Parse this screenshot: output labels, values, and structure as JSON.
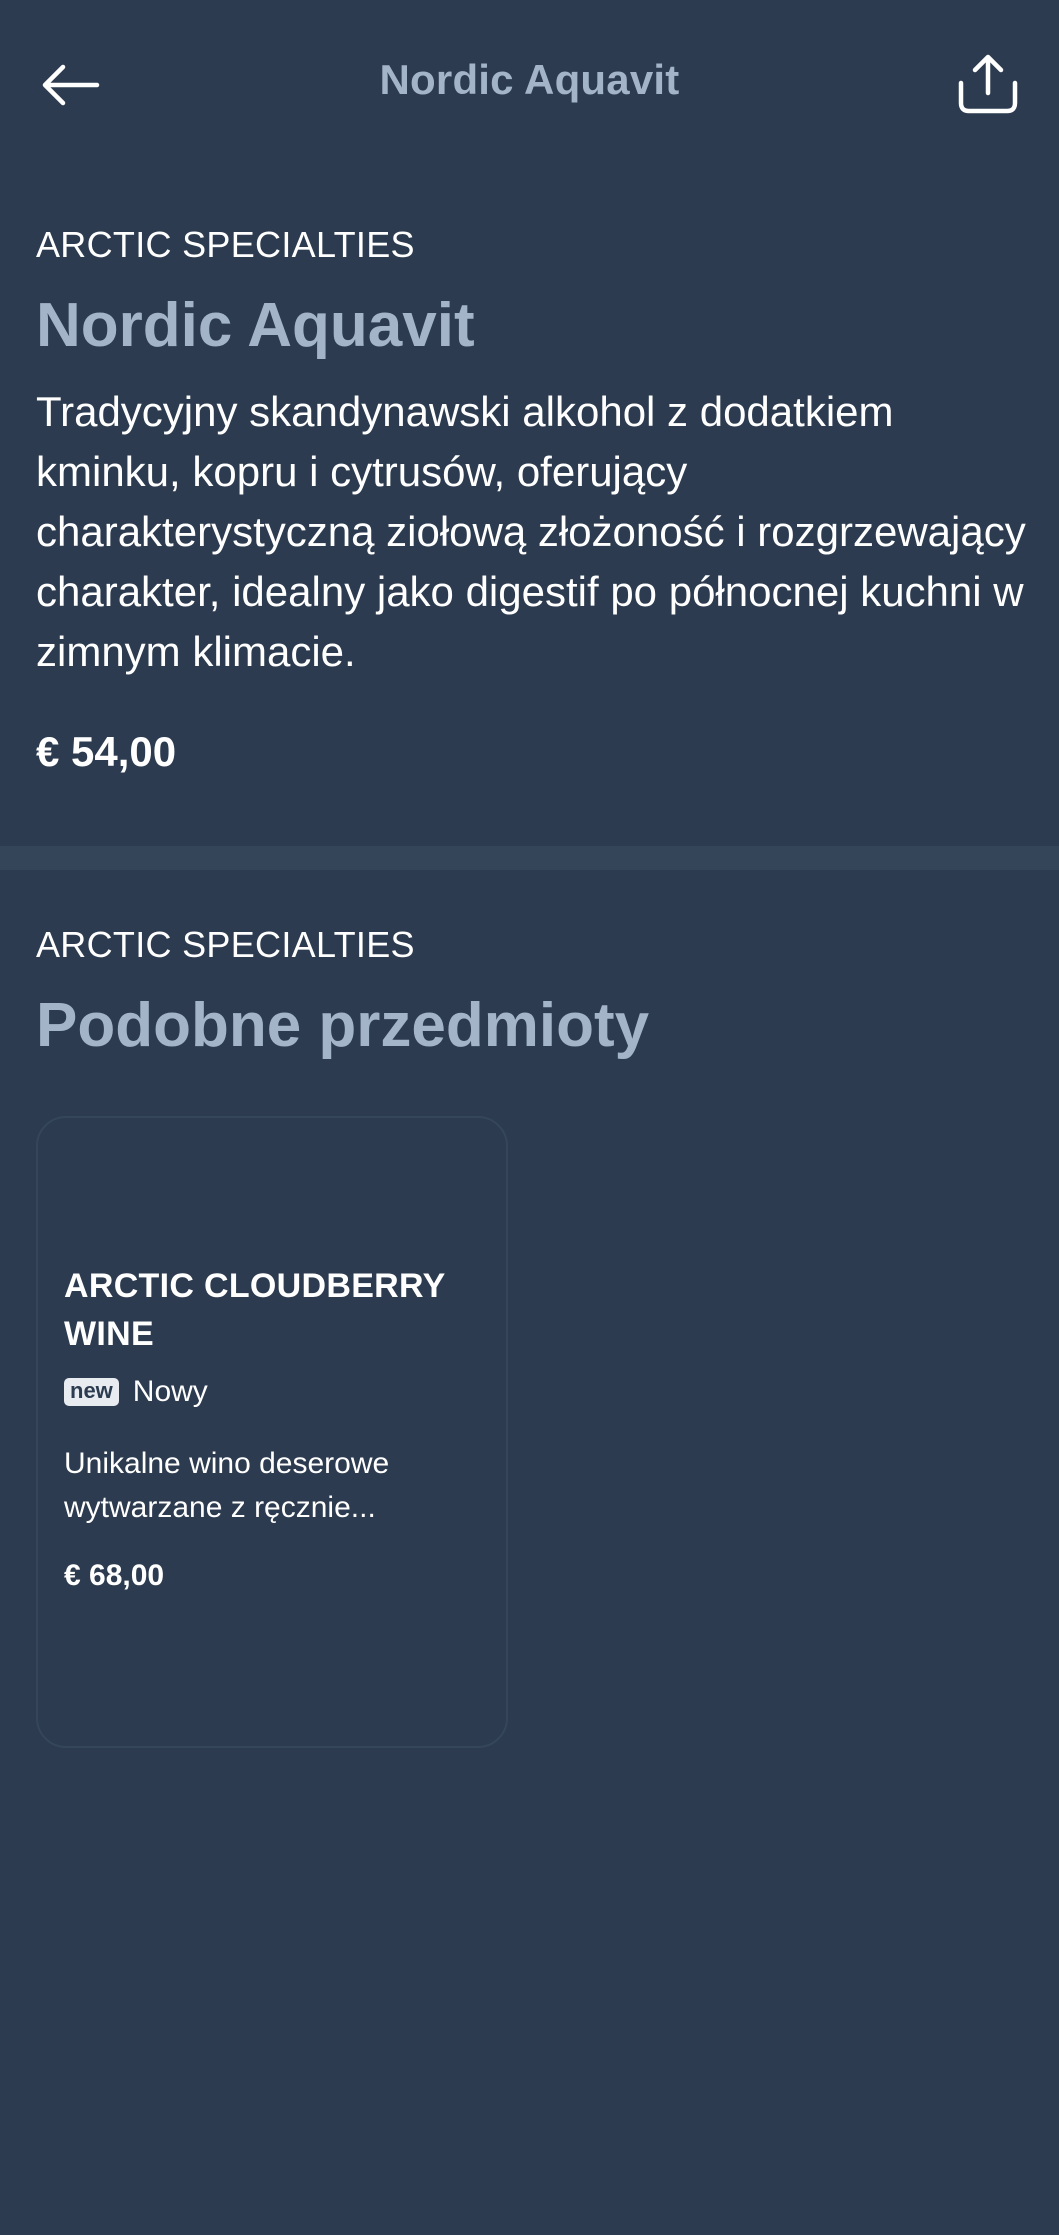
{
  "header": {
    "title": "Nordic Aquavit",
    "back_icon": "arrow-left-icon",
    "share_icon": "share-icon"
  },
  "product": {
    "category": "ARCTIC SPECIALTIES",
    "title": "Nordic Aquavit",
    "description": "Tradycyjny skandynawski alkohol z dodatkiem kminku, kopru i cytrusów, oferujący charakterystyczną ziołową złożoność i rozgrzewający charakter, idealny jako digestif po północnej kuchni w zimnym klimacie.",
    "price": "€ 54,00"
  },
  "similar": {
    "category": "ARCTIC SPECIALTIES",
    "title": "Podobne przedmioty",
    "items": [
      {
        "name": "ARCTIC CLOUDBERRY WINE",
        "badge": "new",
        "badge_label": "Nowy",
        "description": "Unikalne wino deserowe wytwarzane z ręcznie...",
        "price": "€ 68,00"
      }
    ]
  },
  "colors": {
    "background": "#2c3b4f",
    "accent_title": "#a3b3c8",
    "divider": "#34455a",
    "text": "#ffffff"
  }
}
